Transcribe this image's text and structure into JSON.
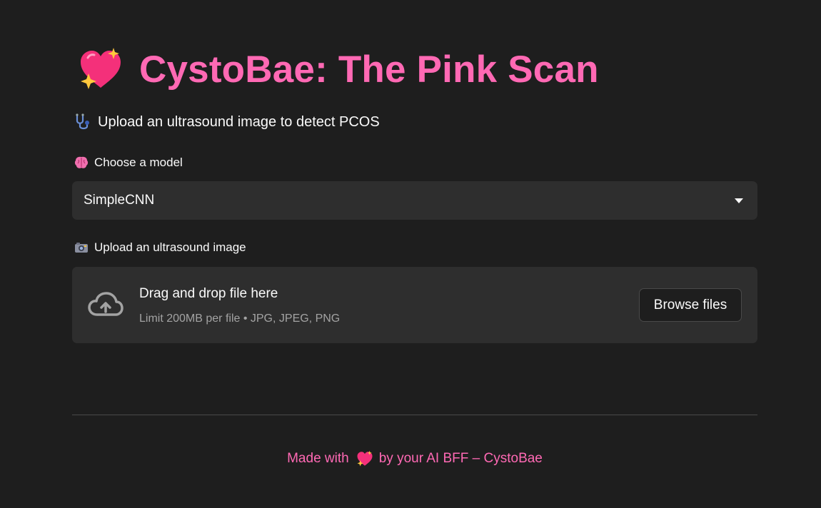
{
  "header": {
    "title": "CystoBae: The Pink Scan",
    "title_icon": "sparkling-heart-icon",
    "subtitle": "Upload an ultrasound image to detect PCOS",
    "subtitle_icon": "stethoscope-icon"
  },
  "model_select": {
    "label": "Choose a model",
    "label_icon": "brain-icon",
    "selected": "SimpleCNN"
  },
  "uploader": {
    "label": "Upload an ultrasound image",
    "label_icon": "camera-icon",
    "drop_title": "Drag and drop file here",
    "limit_text": "Limit 200MB per file • JPG, JPEG, PNG",
    "browse_label": "Browse files",
    "icon": "cloud-upload-icon"
  },
  "footer": {
    "text_before": "Made with",
    "text_after": "by your AI BFF – CystoBae",
    "icon": "sparkling-heart-icon"
  },
  "colors": {
    "background": "#1e1e1e",
    "accent": "#ff69b4",
    "panel": "#2e2e2e"
  }
}
